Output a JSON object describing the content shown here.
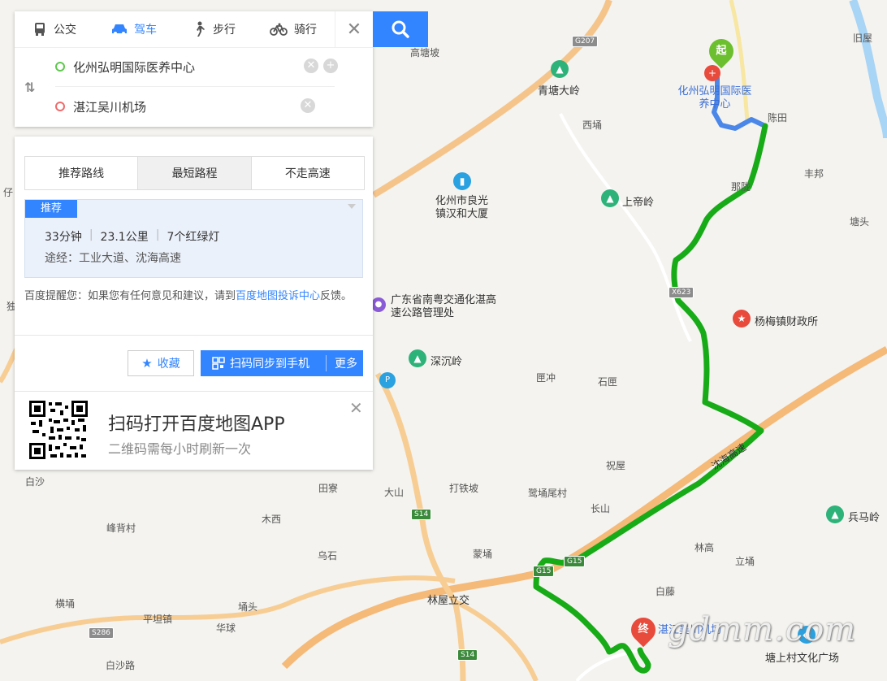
{
  "modes": {
    "bus": "公交",
    "drive": "驾车",
    "walk": "步行",
    "bike": "骑行"
  },
  "route": {
    "start": "化州弘明国际医养中心",
    "end": "湛江吴川机场"
  },
  "route_tabs": [
    "推荐路线",
    "最短路程",
    "不走高速"
  ],
  "result": {
    "tag": "推荐",
    "duration": "33分钟",
    "distance": "23.1公里",
    "lights": "7个红绿灯",
    "via": "途经：工业大道、沈海高速"
  },
  "notice": {
    "prefix": "百度提醒您：如果您有任何意见和建议，请到",
    "link": "百度地图投诉中心",
    "suffix": "反馈。"
  },
  "actions": {
    "favorite": "收藏",
    "sync": "扫码同步到手机",
    "more": "更多"
  },
  "app_promo": {
    "title": "扫码打开百度地图APP",
    "subtitle": "二维码需每小时刷新一次"
  },
  "map": {
    "start_marker": "起",
    "end_marker": "终",
    "start_label": "化州弘明国际医养中心",
    "end_label": "湛江吴川机场",
    "expressway": "沈海高速",
    "places": [
      "高塘坡",
      "青塘大岭",
      "西埇",
      "陈田",
      "旧屋",
      "丰邦",
      "那陇",
      "上帝岭",
      "化州市良光镇汉和大厦",
      "塘头",
      "广东省南粤交通化湛高速公路管理处",
      "杨梅镇财政所",
      "深沉岭",
      "匣冲",
      "石匣",
      "祝屋",
      "大山",
      "打铁坡",
      "鹭埇尾村",
      "长山",
      "兵马岭",
      "白沙",
      "田寮",
      "木西",
      "峰背村",
      "乌石",
      "蒙埇",
      "林高",
      "立埇",
      "白藤",
      "林屋立交",
      "横埇",
      "平坦镇",
      "埇头",
      "华球",
      "白沙路",
      "塘上村文化广场",
      "仔",
      "独"
    ],
    "shields": [
      "G207",
      "X623",
      "S14",
      "G15",
      "G15",
      "S286",
      "S14"
    ]
  },
  "watermark": "gdmm.com",
  "colors": {
    "route_green": "#1aab1a",
    "route_blue": "#4a87e8",
    "accent": "#3385ff",
    "highway": "#f5bd7a"
  }
}
